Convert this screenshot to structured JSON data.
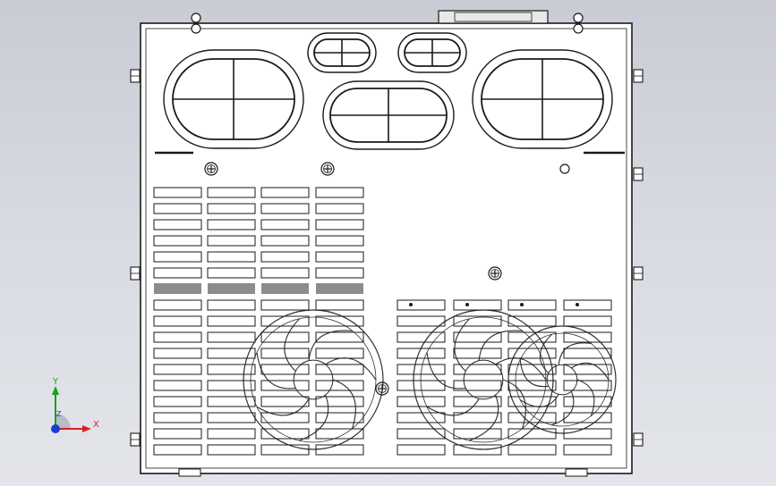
{
  "scene": {
    "background_top": "#c9ccd4",
    "background_bottom": "#e3e5ea",
    "line_color": "#1a1a1a",
    "fill_color": "#ffffff"
  },
  "axis_triad": {
    "x_label": "X",
    "y_label": "Y",
    "z_label": "Z",
    "x_color": "#d62020",
    "y_color": "#1aa01a",
    "z_color": "#1a3ad6"
  }
}
